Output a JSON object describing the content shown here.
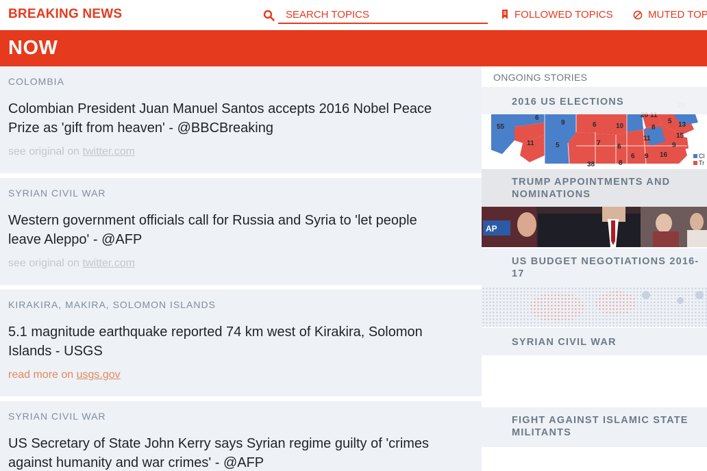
{
  "header": {
    "brand": "BREAKING NEWS",
    "search_placeholder": "SEARCH TOPICS",
    "followed_label": "FOLLOWED TOPICS",
    "muted_label": "MUTED TOPICS",
    "brand_color": "#e63a1e"
  },
  "banner": {
    "title": "NOW"
  },
  "feed": [
    {
      "topic": "COLOMBIA",
      "headline": "Colombian President Juan Manuel Santos accepts 2016 Nobel Peace Prize as 'gift from heaven' - @BBCBreaking",
      "source_prefix": "see original on ",
      "source_link": "twitter.com"
    },
    {
      "topic": "SYRIAN CIVIL WAR",
      "headline": "Western government officials call for Russia and Syria to 'let people leave Aleppo' - @AFP",
      "source_prefix": "see original on ",
      "source_link": "twitter.com"
    },
    {
      "topic": "KIRAKIRA, MAKIRA, SOLOMON ISLANDS",
      "headline": "5.1 magnitude earthquake reported 74 km west of Kirakira, Solomon Islands - USGS",
      "source_prefix": "read more on ",
      "source_link": "usgs.gov"
    },
    {
      "topic": "SYRIAN CIVIL WAR",
      "headline": "US Secretary of State John Kerry says Syrian regime guilty of 'crimes against humanity and war crimes' - @AFP",
      "source_prefix": "",
      "source_link": ""
    }
  ],
  "sidebar": {
    "heading": "ONGOING STORIES",
    "stories": [
      "2016 US ELECTIONS",
      "TRUMP APPOINTMENTS AND NOMINATIONS",
      "US BUDGET NEGOTIATIONS 2016-17",
      "SYRIAN CIVIL WAR",
      "FIGHT AGAINST ISLAMIC STATE MILITANTS"
    ],
    "election_map_numbers": [
      "55",
      "6",
      "9",
      "6",
      "10",
      "8",
      "5",
      "13",
      "11",
      "5",
      "7",
      "6",
      "11",
      "15",
      "6",
      "9",
      "16",
      "9",
      "38",
      "8",
      "20",
      "11"
    ],
    "map_legend": [
      "Cl",
      "Tr"
    ]
  },
  "colors": {
    "accent": "#e63a1e",
    "story_bg": "#eef1f6",
    "topic_text": "#7f8d9c",
    "link_orange": "#e08a5c"
  }
}
